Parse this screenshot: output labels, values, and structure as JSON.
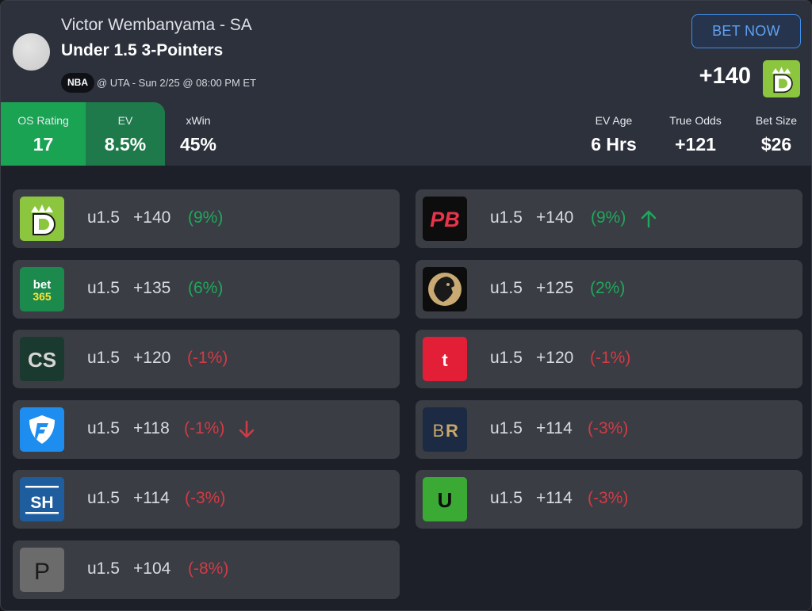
{
  "header": {
    "player": "Victor Wembanyama - SA",
    "market": "Under 1.5 3-Pointers",
    "league": "NBA",
    "game": "@ UTA - Sun 2/25 @ 08:00 PM ET",
    "bet_now": "BET NOW",
    "best_odds": "+140",
    "best_book_icon": "draftkings-logo"
  },
  "stats": {
    "os_rating_label": "OS Rating",
    "os_rating": "17",
    "ev_label": "EV",
    "ev": "8.5%",
    "xwin_label": "xWin",
    "xwin": "45%",
    "ev_age_label": "EV Age",
    "ev_age": "6 Hrs",
    "true_odds_label": "True Odds",
    "true_odds": "+121",
    "bet_size_label": "Bet Size",
    "bet_size": "$26"
  },
  "colors": {
    "positive": "#1fa85b",
    "negative": "#d23b45",
    "accent": "#3f8ee8"
  },
  "books_left": [
    {
      "book": "draftkings",
      "line": "u1.5",
      "odds": "+140",
      "ev": "(9%)"
    },
    {
      "book": "bet365",
      "line": "u1.5",
      "odds": "+135",
      "ev": "(6%)"
    },
    {
      "book": "caesars",
      "line": "u1.5",
      "odds": "+120",
      "ev": "(-1%)"
    },
    {
      "book": "fanduel",
      "line": "u1.5",
      "odds": "+118",
      "ev": "(-1%)",
      "trend": "down"
    },
    {
      "book": "superbook",
      "line": "u1.5",
      "odds": "+114",
      "ev": "(-3%)"
    },
    {
      "book": "pinnacle",
      "line": "u1.5",
      "odds": "+104",
      "ev": "(-8%)"
    }
  ],
  "books_right": [
    {
      "book": "pointsbet",
      "line": "u1.5",
      "odds": "+140",
      "ev": "(9%)",
      "trend": "up"
    },
    {
      "book": "betmgm",
      "line": "u1.5",
      "odds": "+125",
      "ev": "(2%)"
    },
    {
      "book": "tipico",
      "line": "u1.5",
      "odds": "+120",
      "ev": "(-1%)"
    },
    {
      "book": "betrivers",
      "line": "u1.5",
      "odds": "+114",
      "ev": "(-3%)"
    },
    {
      "book": "unibet",
      "line": "u1.5",
      "odds": "+114",
      "ev": "(-3%)"
    }
  ],
  "logo_text": {
    "bet365_top": "bet",
    "bet365_bottom": "365",
    "caesars": "CS",
    "superbook": "SH",
    "pinnacle": "P",
    "pointsbet": "PB",
    "tipico": "t",
    "betrivers_b": "B",
    "betrivers_r": "R",
    "unibet": "U"
  }
}
